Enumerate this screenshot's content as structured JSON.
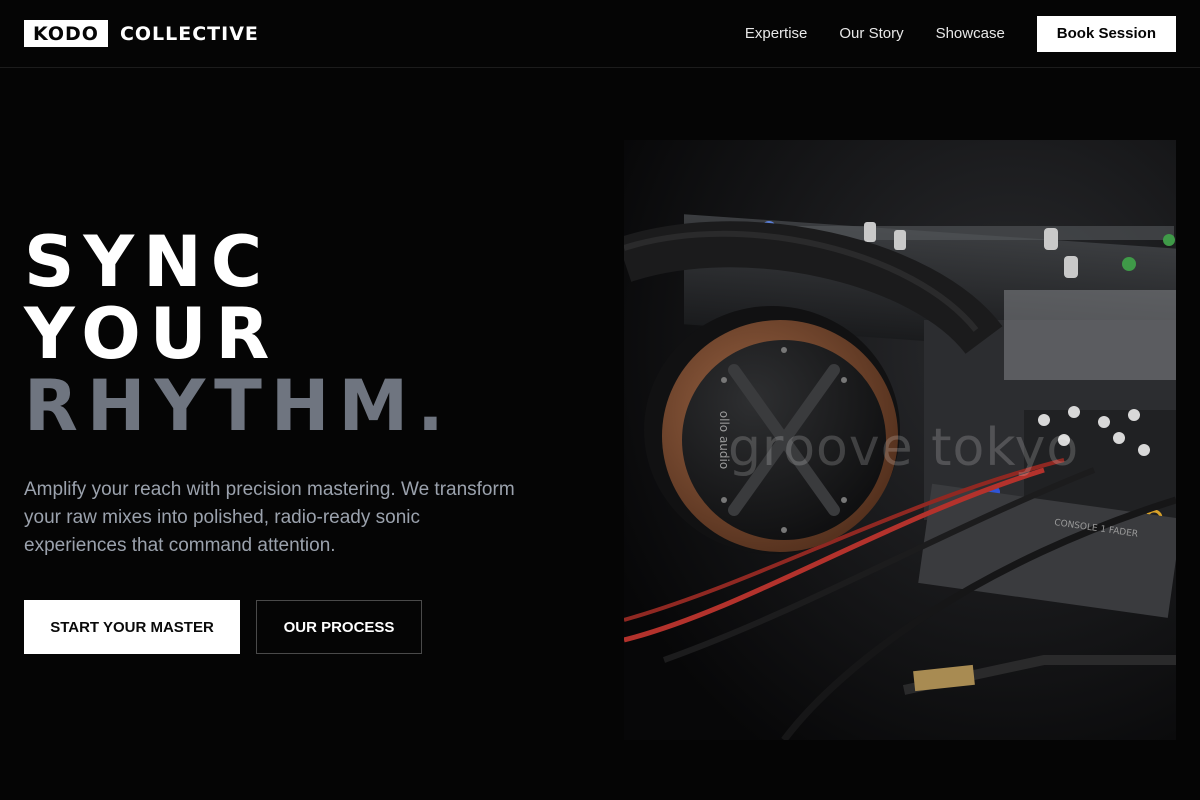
{
  "nav": {
    "logo_box": "KODO",
    "logo_word": "COLLECTIVE",
    "links": [
      "Expertise",
      "Our Story",
      "Showcase"
    ],
    "cta": "Book Session"
  },
  "hero": {
    "headline": [
      "SYNC",
      "YOUR",
      "RHYTHM."
    ],
    "subtitle": "Amplify your reach with precision mastering. We transform your raw mixes into polished, radio-ready sonic experiences that command attention.",
    "primary_cta": "START YOUR MASTER",
    "secondary_cta": "OUR PROCESS",
    "image": {
      "watermark": "groove tokyo",
      "headphone_brand": "ollo audio",
      "console_label": "CONSOLE 1 FADER"
    }
  },
  "colors": {
    "background": "#050505",
    "headline_accent": "#6f7580",
    "subtitle": "#9ba2ad",
    "cable_red": "#b3322c",
    "wood": "#7a4a30"
  }
}
